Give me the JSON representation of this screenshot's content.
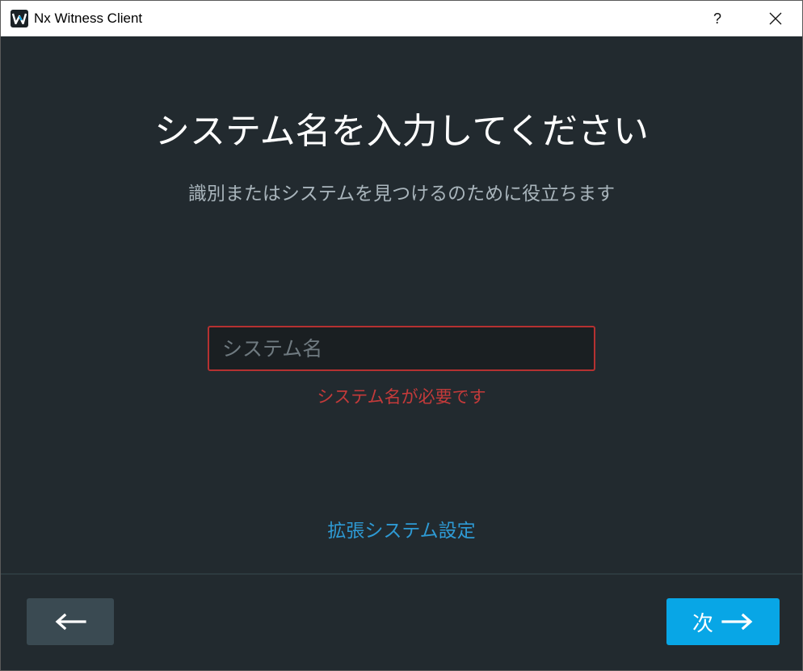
{
  "window": {
    "title": "Nx Witness Client",
    "help_label": "?",
    "close_label": "✕"
  },
  "main": {
    "heading": "システム名を入力してください",
    "subheading": "識別またはシステムを見つけるのために役立ちます",
    "input": {
      "value": "",
      "placeholder": "システム名"
    },
    "error": "システム名が必要です",
    "advanced_link": "拡張システム設定"
  },
  "footer": {
    "back_icon": "arrow-left-icon",
    "next_label": "次",
    "next_icon": "arrow-right-icon"
  },
  "colors": {
    "background": "#222a2f",
    "accent": "#08a6e6",
    "error": "#c43a3a",
    "link": "#2e9ad4"
  }
}
